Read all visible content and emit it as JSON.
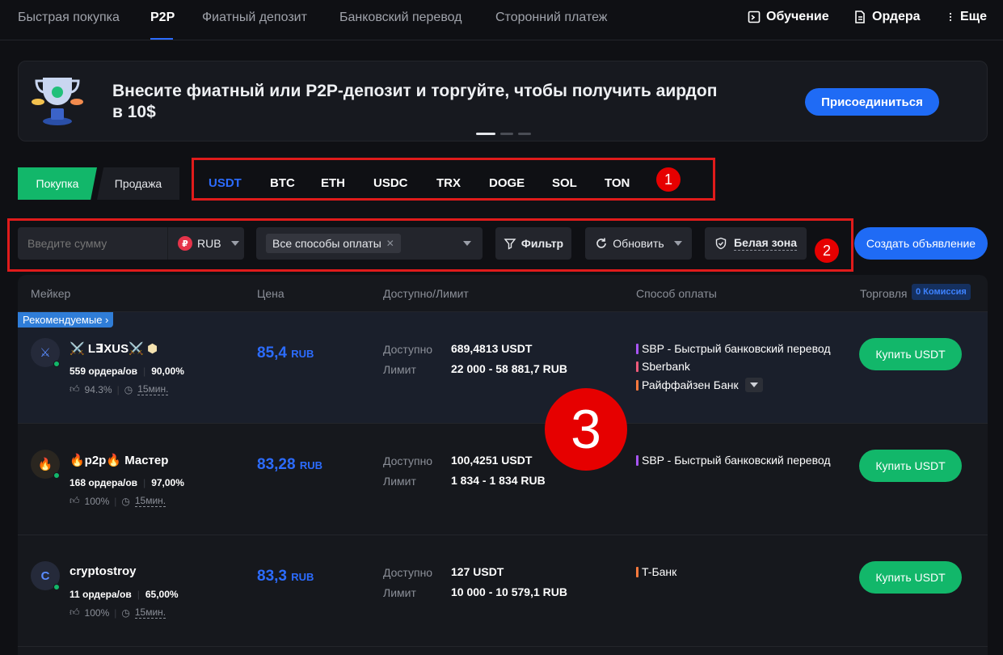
{
  "nav": {
    "tabs": [
      "Быстрая покупка",
      "P2P",
      "Фиатный депозит",
      "Банковский перевод",
      "Сторонний платеж"
    ],
    "learn": "Обучение",
    "orders": "Ордера",
    "more": "Еще"
  },
  "banner": {
    "title": "Внесите фиатный или P2P-депозит и торгуйте, чтобы получить аирдоп в 10$",
    "join": "Присоединиться"
  },
  "trade": {
    "buy": "Покупка",
    "sell": "Продажа"
  },
  "coins": [
    "USDT",
    "BTC",
    "ETH",
    "USDC",
    "TRX",
    "DOGE",
    "SOL",
    "TON"
  ],
  "annotations": {
    "one": "1",
    "two": "2",
    "three": "3"
  },
  "filters": {
    "amount_placeholder": "Введите сумму",
    "currency": "RUB",
    "currency_symbol": "₽",
    "payment_chip": "Все способы оплаты",
    "filter": "Фильтр",
    "refresh": "Обновить",
    "white_zone": "Белая зона",
    "create_ad": "Создать объявление"
  },
  "table": {
    "headers": {
      "maker": "Мейкер",
      "price": "Цена",
      "available": "Доступно/Лимит",
      "payment": "Способ оплаты",
      "trade": "Торговля",
      "commission": "0 Комиссия"
    },
    "recommended": "Рекомендуемые",
    "available_label": "Доступно",
    "limit_label": "Лимит",
    "rows": [
      {
        "name": "⚔️ L∃XUS⚔️",
        "avatar": "⚔",
        "orders": "559 ордера/ов",
        "rate": "90,00%",
        "likes": "94.3%",
        "time": "15мин.",
        "price": "85,4",
        "price_cur": "RUB",
        "available": "689,4813 USDT",
        "limit": "22 000 - 58 881,7 RUB",
        "payments": [
          "SBP - Быстрый банковский перевод",
          "Sberbank",
          "Райффайзен Банк"
        ],
        "button": "Купить USDT"
      },
      {
        "name": "🔥p2p🔥 Мастер",
        "avatar": "🔥",
        "orders": "168 ордера/ов",
        "rate": "97,00%",
        "likes": "100%",
        "time": "15мин.",
        "price": "83,28",
        "price_cur": "RUB",
        "available": "100,4251 USDT",
        "limit": "1 834 - 1 834 RUB",
        "payments": [
          "SBP - Быстрый банковский перевод"
        ],
        "button": "Купить USDT"
      },
      {
        "name": "cryptostroy",
        "avatar": "C",
        "orders": "11 ордера/ов",
        "rate": "65,00%",
        "likes": "100%",
        "time": "15мин.",
        "price": "83,3",
        "price_cur": "RUB",
        "available": "127 USDT",
        "limit": "10 000 - 10 579,1 RUB",
        "payments": [
          "T-Банк"
        ],
        "button": "Купить USDT"
      }
    ]
  },
  "colors": {
    "accent": "#2c6cff",
    "green": "#12b76a",
    "red": "#e01b1b",
    "sbp": "#a855f7",
    "sber": "#ef5a7a",
    "bank": "#ff7a3d"
  }
}
